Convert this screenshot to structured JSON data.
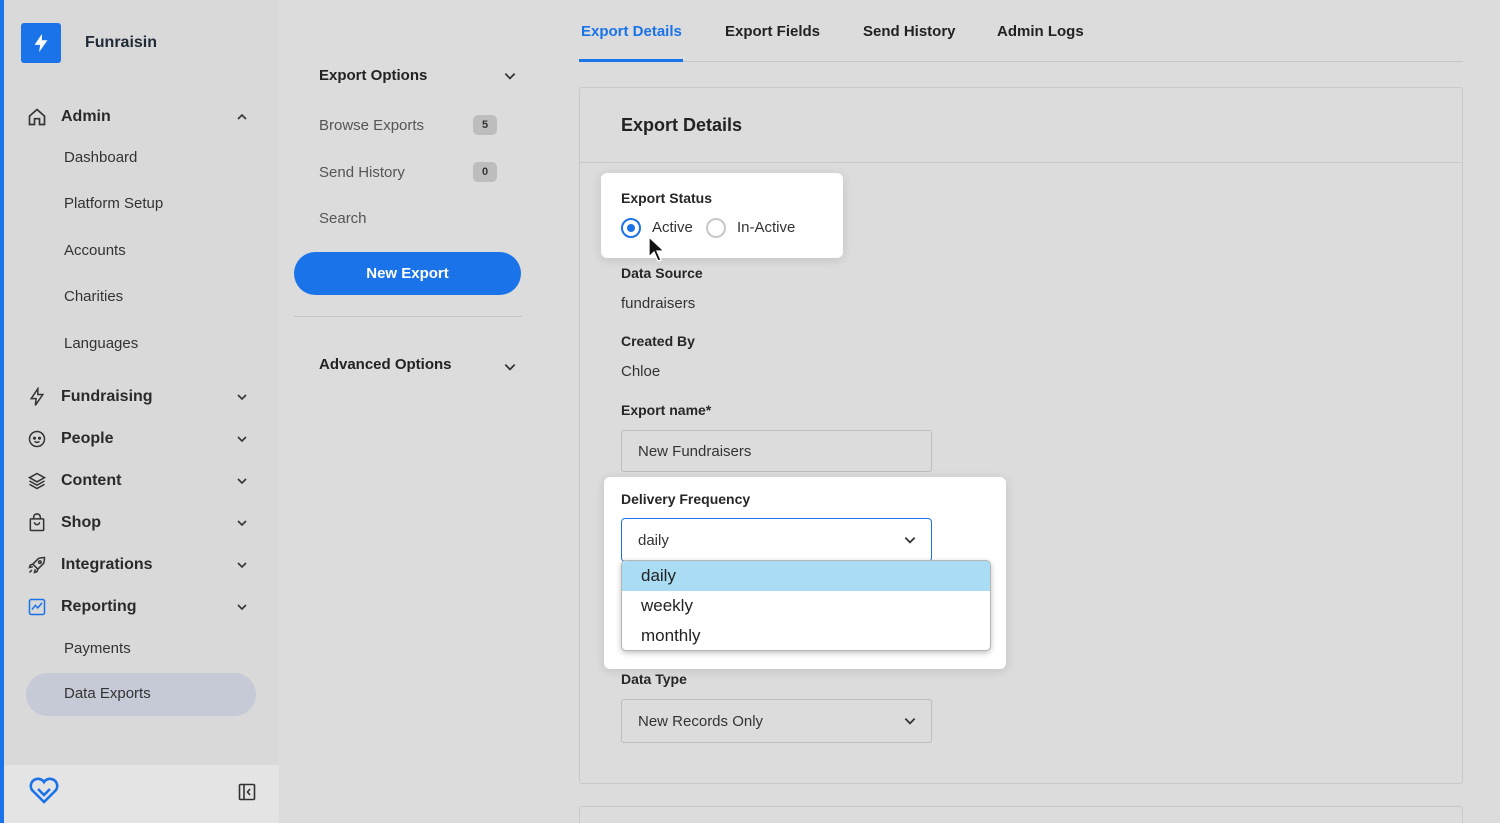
{
  "brand": {
    "name": "Funraisin"
  },
  "sidebar": {
    "groups": [
      {
        "label": "Admin",
        "icon": "home-icon",
        "expanded": true
      },
      {
        "label": "Fundraising",
        "icon": "bolt-icon",
        "expanded": false
      },
      {
        "label": "People",
        "icon": "face-icon",
        "expanded": false
      },
      {
        "label": "Content",
        "icon": "layers-icon",
        "expanded": false
      },
      {
        "label": "Shop",
        "icon": "shopping-bag-icon",
        "expanded": false
      },
      {
        "label": "Integrations",
        "icon": "rocket-icon",
        "expanded": false
      },
      {
        "label": "Reporting",
        "icon": "chart-icon",
        "expanded": true
      }
    ],
    "admin_items": [
      "Dashboard",
      "Platform Setup",
      "Accounts",
      "Charities",
      "Languages"
    ],
    "reporting_items": [
      "Payments",
      "Data Exports"
    ],
    "active_item": "Data Exports"
  },
  "subnav": {
    "export_options_title": "Export Options",
    "items": [
      {
        "label": "Browse Exports",
        "badge": "5"
      },
      {
        "label": "Send History",
        "badge": "0"
      },
      {
        "label": "Search"
      }
    ],
    "new_export_label": "New Export",
    "advanced_options_title": "Advanced Options"
  },
  "tabs": [
    "Export Details",
    "Export Fields",
    "Send History",
    "Admin Logs"
  ],
  "active_tab": "Export Details",
  "card": {
    "title": "Export Details",
    "export_status": {
      "label": "Export Status",
      "options": [
        "Active",
        "In-Active"
      ],
      "selected": "Active"
    },
    "data_source": {
      "label": "Data Source",
      "value": "fundraisers"
    },
    "created_by": {
      "label": "Created By",
      "value": "Chloe"
    },
    "export_name": {
      "label": "Export name*",
      "value": "New Fundraisers"
    },
    "delivery_frequency": {
      "label": "Delivery Frequency",
      "value": "daily",
      "options": [
        "daily",
        "weekly",
        "monthly"
      ]
    },
    "data_type": {
      "label": "Data Type",
      "value": "New Records Only"
    }
  },
  "colors": {
    "accent": "#1a73e8",
    "dropdown_highlight": "#aadcf3"
  }
}
